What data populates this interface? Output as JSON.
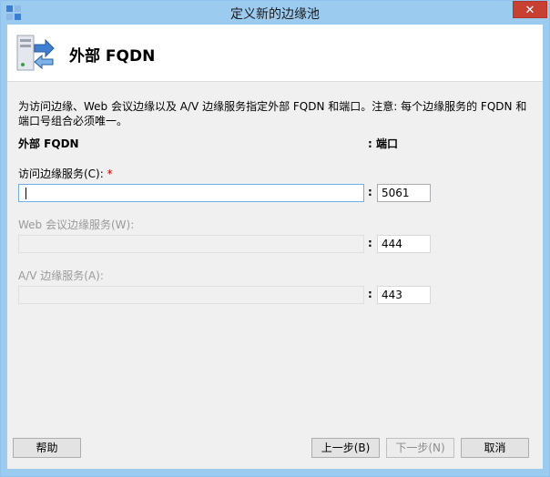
{
  "window": {
    "title": "定义新的边缘池",
    "close_glyph": "✕"
  },
  "header": {
    "title": "外部 FQDN",
    "icon": "server-arrows-icon"
  },
  "description": "为访问边缘、Web 会议边缘以及 A/V 边缘服务指定外部 FQDN 和端口。注意: 每个边缘服务的 FQDN 和端口号组合必须唯一。",
  "columns": {
    "fqdn": "外部 FQDN",
    "port": ": 端口"
  },
  "fields": {
    "access": {
      "label": "访问边缘服务(C):",
      "required_mark": "*",
      "value": "",
      "port": "5061"
    },
    "web": {
      "label": "Web 会议边缘服务(W):",
      "value": "",
      "port": "444"
    },
    "av": {
      "label": "A/V 边缘服务(A):",
      "value": "",
      "port": "443"
    }
  },
  "colon": ":",
  "buttons": {
    "help": "帮助",
    "back": "上一步(B)",
    "next": "下一步(N)",
    "cancel": "取消"
  },
  "colors": {
    "titlebar": "#9ccbf0",
    "close": "#c84031",
    "required": "#cc0000"
  }
}
